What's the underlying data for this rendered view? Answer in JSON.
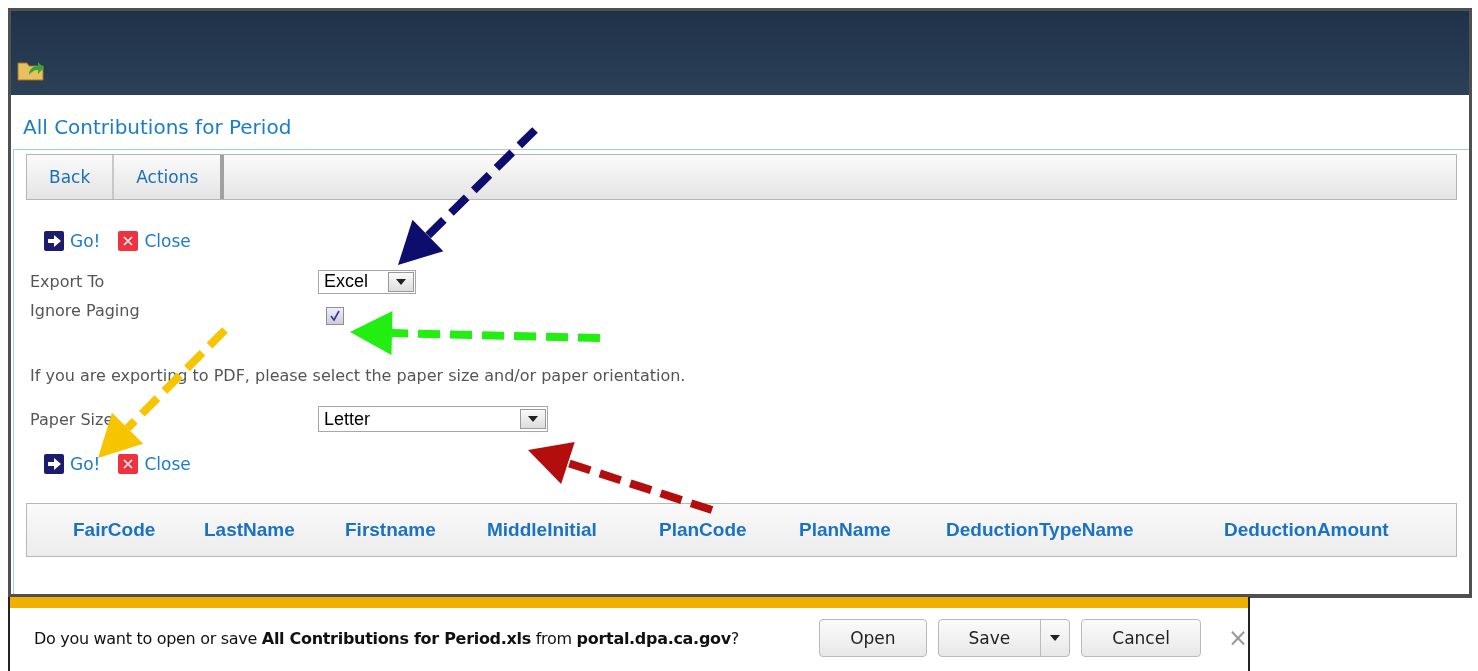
{
  "page": {
    "title": "All Contributions for Period"
  },
  "toolbar": [
    {
      "label": "Back"
    },
    {
      "label": "Actions"
    }
  ],
  "top_actions": [
    {
      "kind": "go",
      "label": "Go!"
    },
    {
      "kind": "close",
      "label": "Close"
    }
  ],
  "export_to": {
    "label": "Export To",
    "value": "Excel"
  },
  "ignore_paging": {
    "label": "Ignore Paging",
    "checked": true
  },
  "pdf_note": "If you are exporting to PDF, please select the paper size and/or paper orientation.",
  "paper_size": {
    "label": "Paper Size",
    "value": "Letter"
  },
  "bottom_actions": [
    {
      "kind": "go",
      "label": "Go!"
    },
    {
      "kind": "close",
      "label": "Close"
    }
  ],
  "table": {
    "columns": [
      "FairCode",
      "LastName",
      "Firstname",
      "MiddleInitial",
      "PlanCode",
      "PlanName",
      "DeductionTypeName",
      "DeductionAmount"
    ]
  },
  "annotations": [
    {
      "kind": "arrow",
      "color": "#0d0d6e"
    },
    {
      "kind": "arrow",
      "color": "#22ee11"
    },
    {
      "kind": "arrow",
      "color": "#f7c400"
    },
    {
      "kind": "arrow",
      "color": "#b30d0d"
    }
  ],
  "download_bar": {
    "message": "Do you want to open or save **All Contributions for Period.xls** from **portal.dpa.ca.gov**?",
    "buttons": [
      {
        "kind": "plain",
        "label": "Open"
      },
      {
        "kind": "split",
        "label": "Save"
      },
      {
        "kind": "plain",
        "label": "Cancel"
      }
    ],
    "close": "×"
  }
}
